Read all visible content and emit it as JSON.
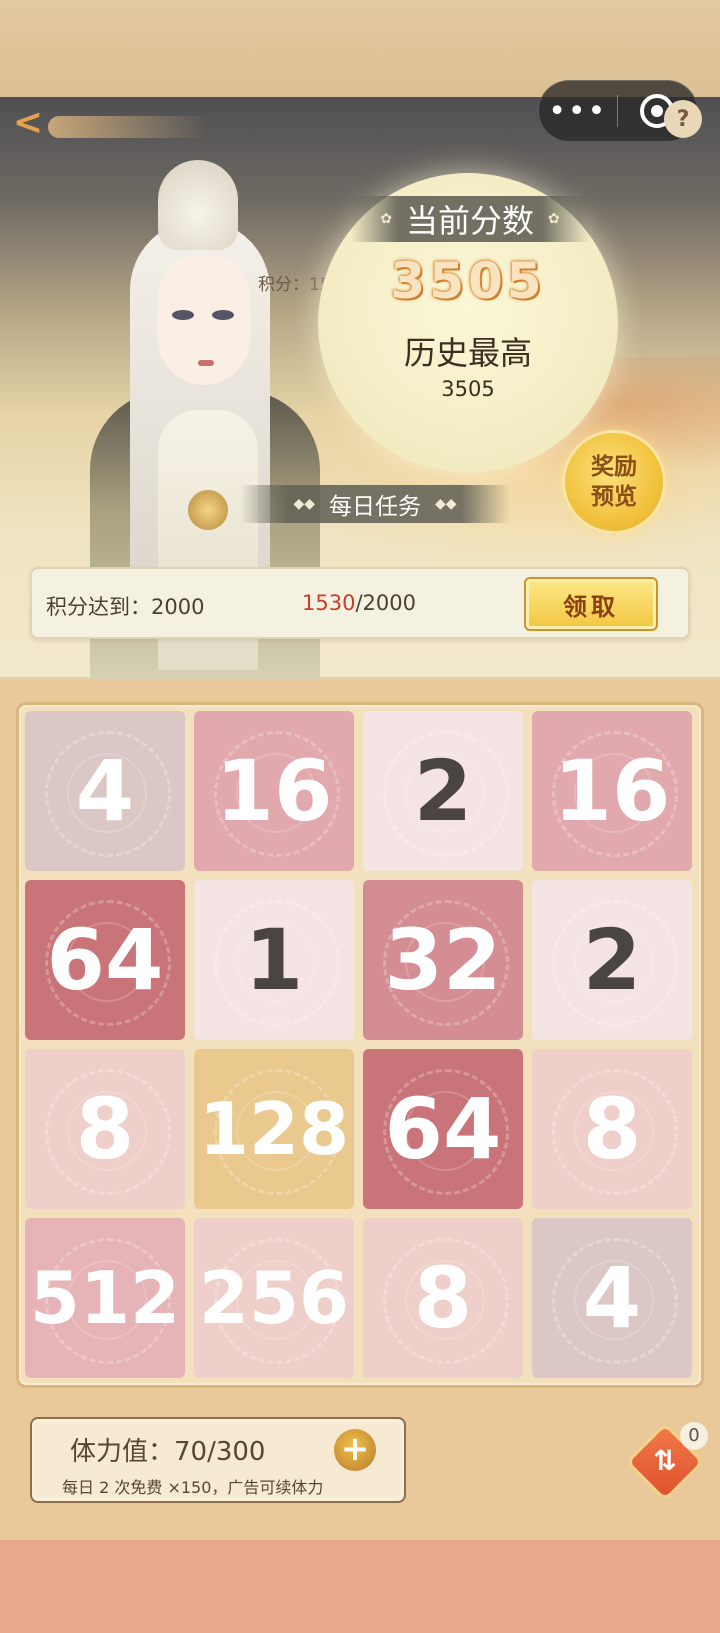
{
  "header": {
    "back_label": "<",
    "capsule_more": "•••",
    "help_label": "?"
  },
  "score": {
    "inline_points": "积分：1530",
    "current_title": "当前分数",
    "current_value": "3505",
    "best_title": "历史最高",
    "best_value": "3505"
  },
  "reward_preview": {
    "line1": "奖励",
    "line2": "预览"
  },
  "daily_task": {
    "title": "每日任务",
    "requirement": "积分达到：2000",
    "progress_current": "1530",
    "progress_total": "/2000",
    "progress_fraction": 0.765,
    "claim_label": "领取"
  },
  "board": {
    "tiles": [
      {
        "value": "4",
        "color": "#dcc7c7"
      },
      {
        "value": "16",
        "color": "#e1a9ad"
      },
      {
        "value": "2",
        "color": "#f5e4e4"
      },
      {
        "value": "16",
        "color": "#e1a9ad"
      },
      {
        "value": "64",
        "color": "#c97478"
      },
      {
        "value": "1",
        "color": "#f5e4e4"
      },
      {
        "value": "32",
        "color": "#d38d93"
      },
      {
        "value": "2",
        "color": "#f5e4e4"
      },
      {
        "value": "8",
        "color": "#efcfc9"
      },
      {
        "value": "128",
        "color": "#eac98e"
      },
      {
        "value": "64",
        "color": "#c97478"
      },
      {
        "value": "8",
        "color": "#efcfc9"
      },
      {
        "value": "512",
        "color": "#e6b3b7"
      },
      {
        "value": "256",
        "color": "#efcfc9"
      },
      {
        "value": "8",
        "color": "#efcfc9"
      },
      {
        "value": "4",
        "color": "#dcc7c7"
      }
    ]
  },
  "stamina": {
    "label": "体力值：70/300",
    "plus": "+",
    "note": "每日 2 次免费 ×150，广告可续体力"
  },
  "refresh": {
    "glyph": "⇅",
    "count": "0"
  },
  "colors": {
    "accent_gold": "#f2c63f",
    "progress_red": "#c83d2b"
  }
}
